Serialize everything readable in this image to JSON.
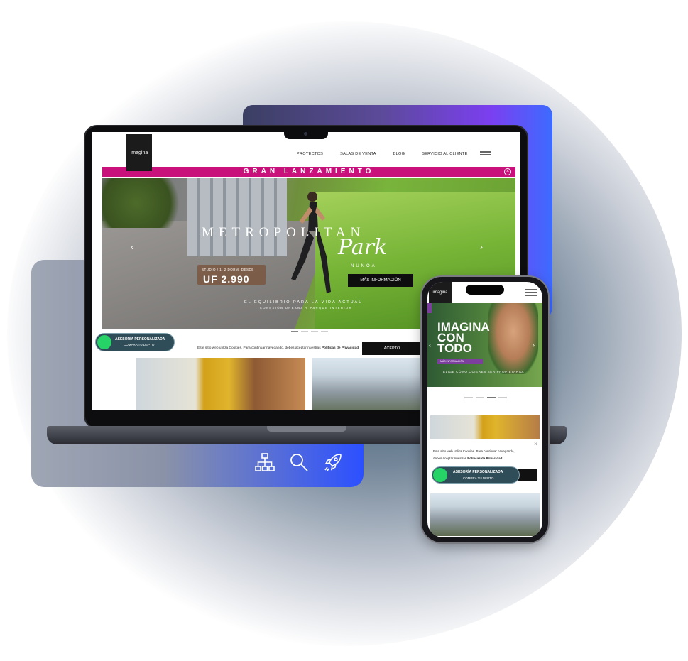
{
  "desktop": {
    "logo": "imagina",
    "nav": [
      "PROYECTOS",
      "SALAS DE VENTA",
      "BLOG",
      "SERVICIO AL CLIENTE"
    ],
    "banner": "GRAN LANZAMIENTO",
    "hero": {
      "title_line": "METROPOLITAN",
      "script_title": "Park",
      "location": "ÑUÑOA",
      "price_sub": "STUDIO / 1, 2 DORM. DESDE",
      "price": "UF 2.990",
      "cta": "MÁS INFORMACIÓN",
      "tagline": "EL EQUILIBRIO PARA LA VIDA ACTUAL",
      "subtagline": "CONEXIÓN URBANA Y PARQUE INTERIOR"
    },
    "whatsapp": {
      "title": "ASESORÍA PERSONALIZADA",
      "subtitle": "COMPRA TU DEPTO"
    },
    "cookie": {
      "text": "Este sitio web utiliza Cookies. Para continuar navegando, debes aceptar nuestras",
      "link": "Políticas de Privacidad",
      "accept": "ACEPTO"
    }
  },
  "mobile": {
    "logo": "imagina",
    "hero_title": "IMAGINA CON TODO",
    "cta": "MÁS INFORMACIÓN",
    "tagline": "ELIGE CÓMO QUIERES SER PROPIETARIO.",
    "cookie_line1": "Este sitio web utiliza Cookies. Para continuar navegando,",
    "cookie_line2": "debes aceptar nuestras",
    "cookie_link": "Políticas de Privacidad",
    "whatsapp": {
      "title": "ASESORÍA PERSONALIZADA",
      "subtitle": "COMPRA TU DEPTO"
    }
  },
  "icons": [
    "sitemap-icon",
    "search-icon",
    "rocket-icon"
  ],
  "colors": {
    "banner": "#c8117a",
    "whatsapp": "#25d366",
    "accent_purple": "#7c3f9e"
  }
}
